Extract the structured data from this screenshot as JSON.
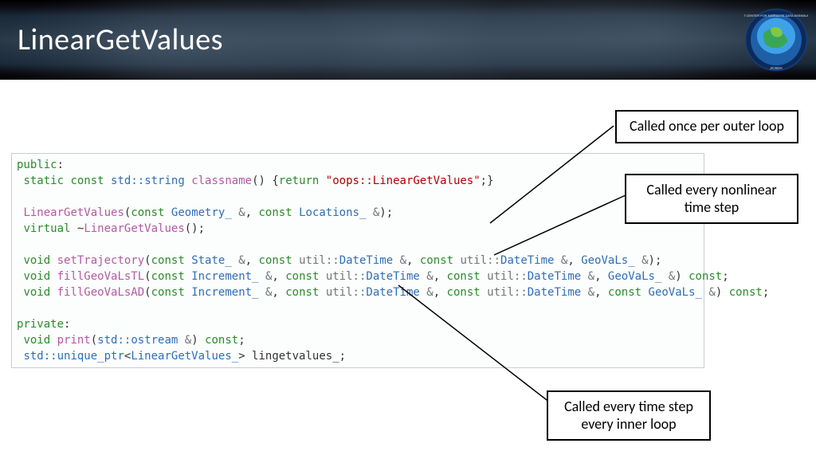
{
  "header": {
    "title": "LinearGetValues"
  },
  "callouts": {
    "outer": "Called once per outer loop",
    "nonlin": "Called every nonlinear\ntime step",
    "inner": "Called every time step\nevery inner loop"
  },
  "code": {
    "l1_public": "public",
    "l2_static": "static",
    "l2_const": "const",
    "l2_stdstring": "std::string",
    "l2_classname": "classname",
    "l2_return": "return",
    "l2_str": "\"oops::LinearGetValues\"",
    "l4_name": "LinearGetValues",
    "l4_const1": "const",
    "l4_geom": "Geometry_",
    "l4_amp": "&",
    "l4_const2": "const",
    "l4_loc": "Locations_",
    "l5_virtual": "virtual",
    "l5_name": "LinearGetValues",
    "l7_void": "void",
    "l7_name": "setTrajectory",
    "l7_const1": "const",
    "l7_state": "State_",
    "l7_amp": "&",
    "l7_const2": "const",
    "l7_util": "util::",
    "l7_dt": "DateTime",
    "l7_const3": "const",
    "l7_gv": "GeoVaLs_",
    "l8_void": "void",
    "l8_name": "fillGeoVaLsTL",
    "l8_const1": "const",
    "l8_inc": "Increment_",
    "l8_const2": "const",
    "l8_util": "util::",
    "l8_dt": "DateTime",
    "l8_const3": "const",
    "l8_gv": "GeoVaLs_",
    "l8_constend": "const",
    "l9_void": "void",
    "l9_name": "fillGeoVaLsAD",
    "l9_const1": "const",
    "l9_inc": "Increment_",
    "l9_const2": "const",
    "l9_util": "util::",
    "l9_dt": "DateTime",
    "l9_const3": "const",
    "l9_const4": "const",
    "l9_gv": "GeoVaLs_",
    "l9_constend": "const",
    "l11_private": "private",
    "l12_void": "void",
    "l12_name": "print",
    "l12_ostream": "std::ostream",
    "l12_amp": "&",
    "l12_const": "const",
    "l13_unique": "std::unique_ptr",
    "l13_lgv": "LinearGetValues_",
    "l13_var": "lingetvalues_"
  }
}
